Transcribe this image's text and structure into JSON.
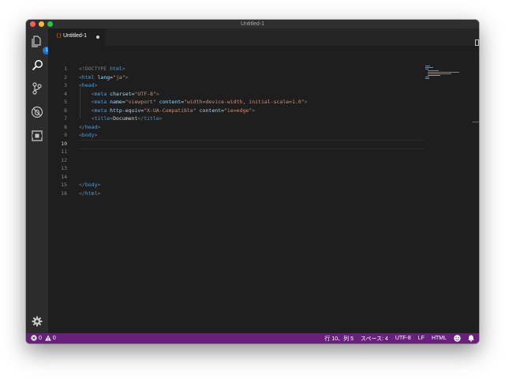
{
  "window": {
    "title": "Untitled-1"
  },
  "activity_bar": {
    "explorer_badge": "1"
  },
  "tabs": [
    {
      "label": "Untitled-1",
      "icon": "{}"
    }
  ],
  "editor": {
    "active_line": 10,
    "lines": [
      {
        "n": "1",
        "segs": [
          [
            "dim",
            "<!DOCTYPE "
          ],
          [
            "tag",
            "html"
          ],
          [
            "dim",
            ">"
          ]
        ]
      },
      {
        "n": "2",
        "segs": [
          [
            "dim",
            "<"
          ],
          [
            "tag",
            "html "
          ],
          [
            "attr",
            "lang"
          ],
          [
            "txt",
            "="
          ],
          [
            "str",
            "\"ja\""
          ],
          [
            "dim",
            ">"
          ]
        ]
      },
      {
        "n": "3",
        "segs": [
          [
            "dim",
            "<"
          ],
          [
            "tag",
            "head"
          ],
          [
            "dim",
            ">"
          ]
        ]
      },
      {
        "n": "4",
        "segs": [
          [
            "txt",
            "    "
          ],
          [
            "dim",
            "<"
          ],
          [
            "tag",
            "meta "
          ],
          [
            "attr",
            "charset"
          ],
          [
            "txt",
            "="
          ],
          [
            "str",
            "\"UTF-8\""
          ],
          [
            "dim",
            ">"
          ]
        ]
      },
      {
        "n": "5",
        "segs": [
          [
            "txt",
            "    "
          ],
          [
            "dim",
            "<"
          ],
          [
            "tag",
            "meta "
          ],
          [
            "attr",
            "name"
          ],
          [
            "txt",
            "="
          ],
          [
            "str",
            "\"viewport\" "
          ],
          [
            "attr",
            "content"
          ],
          [
            "txt",
            "="
          ],
          [
            "str",
            "\"width=device-width, initial-scale=1.0\""
          ],
          [
            "dim",
            ">"
          ]
        ]
      },
      {
        "n": "6",
        "segs": [
          [
            "txt",
            "    "
          ],
          [
            "dim",
            "<"
          ],
          [
            "tag",
            "meta "
          ],
          [
            "attr",
            "http-equiv"
          ],
          [
            "txt",
            "="
          ],
          [
            "str",
            "\"X-UA-Compatible\" "
          ],
          [
            "attr",
            "content"
          ],
          [
            "txt",
            "="
          ],
          [
            "str",
            "\"ie=edge\""
          ],
          [
            "dim",
            ">"
          ]
        ]
      },
      {
        "n": "7",
        "segs": [
          [
            "txt",
            "    "
          ],
          [
            "dim",
            "<"
          ],
          [
            "tag",
            "title"
          ],
          [
            "dim",
            ">"
          ],
          [
            "txt",
            "Document"
          ],
          [
            "dim",
            "</"
          ],
          [
            "tag",
            "title"
          ],
          [
            "dim",
            ">"
          ]
        ]
      },
      {
        "n": "8",
        "segs": [
          [
            "dim",
            "</"
          ],
          [
            "tag",
            "head"
          ],
          [
            "dim",
            ">"
          ]
        ]
      },
      {
        "n": "9",
        "segs": [
          [
            "dim",
            "<"
          ],
          [
            "tag",
            "body"
          ],
          [
            "dim",
            ">"
          ]
        ]
      },
      {
        "n": "10",
        "segs": []
      },
      {
        "n": "11",
        "segs": []
      },
      {
        "n": "12",
        "segs": []
      },
      {
        "n": "13",
        "segs": []
      },
      {
        "n": "14",
        "segs": []
      },
      {
        "n": "15",
        "segs": [
          [
            "dim",
            "</"
          ],
          [
            "tag",
            "body"
          ],
          [
            "dim",
            ">"
          ]
        ]
      },
      {
        "n": "16",
        "segs": [
          [
            "dim",
            "</"
          ],
          [
            "tag",
            "html"
          ],
          [
            "dim",
            ">"
          ]
        ]
      }
    ]
  },
  "status_bar": {
    "errors": "0",
    "warnings": "0",
    "cursor_position": "行 10、列 5",
    "indentation": "スペース: 4",
    "encoding": "UTF-8",
    "eol": "LF",
    "language": "HTML"
  },
  "colors": {
    "status_bar": "#68217a",
    "tag": "#569cd6",
    "attribute": "#9cdcfe",
    "string": "#ce9178"
  }
}
